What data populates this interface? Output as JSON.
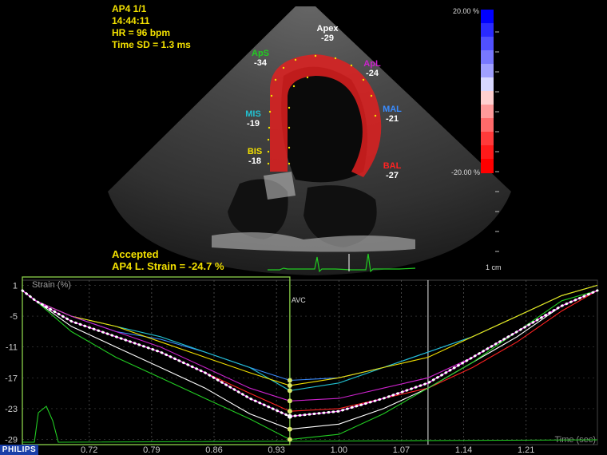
{
  "header": {
    "view": "AP4  1/1",
    "time": "14:44:11",
    "hr": "HR = 96 bpm",
    "time_sd": "Time SD = 1.3 ms"
  },
  "status": {
    "accepted": "Accepted",
    "strain": "AP4 L. Strain = -24.7 %"
  },
  "segments": [
    {
      "name": "Apex",
      "value": "-29",
      "color": "#ffffff"
    },
    {
      "name": "ApS",
      "value": "-34",
      "color": "#22cc22"
    },
    {
      "name": "ApL",
      "value": "-24",
      "color": "#cc22cc"
    },
    {
      "name": "MIS",
      "value": "-19",
      "color": "#22c0d0"
    },
    {
      "name": "MAL",
      "value": "-21",
      "color": "#3a8cff"
    },
    {
      "name": "BIS",
      "value": "-18",
      "color": "#f2e000"
    },
    {
      "name": "BAL",
      "value": "-27",
      "color": "#ff2222"
    }
  ],
  "colorbar": {
    "max": "20.00 %",
    "min": "-20.00 %"
  },
  "scale_label": "1 cm",
  "branding": "PHILIPS",
  "chart_data": {
    "type": "line",
    "ylabel": "Strain (%)",
    "xlabel": "Time (sec)",
    "marker_label": "AVC",
    "avc_time": 0.945,
    "cursor_time": 1.1,
    "xlim": [
      0.645,
      1.29
    ],
    "ylim": [
      -30,
      2
    ],
    "xticks": [
      "0.72",
      "0.79",
      "0.86",
      "0.93",
      "1.00",
      "1.07",
      "1.14",
      "1.21"
    ],
    "yticks": [
      "1",
      "-5",
      "-11",
      "-17",
      "-23",
      "-29"
    ],
    "x": [
      0.645,
      0.66,
      0.7,
      0.75,
      0.8,
      0.85,
      0.9,
      0.945,
      1.0,
      1.05,
      1.1,
      1.15,
      1.2,
      1.25,
      1.29
    ],
    "series": [
      {
        "name": "MAL",
        "color": "#3a8cff",
        "values": [
          0,
          -2,
          -5,
          -8,
          -9.5,
          -12,
          -15,
          -17.5,
          -17,
          -15,
          -12,
          -9,
          -5,
          -1,
          1
        ]
      },
      {
        "name": "MIS",
        "color": "#22c0d0",
        "values": [
          0,
          -2,
          -5,
          -7,
          -9,
          -12,
          -15,
          -19.5,
          -18,
          -15,
          -12,
          -9,
          -5,
          -1,
          1
        ]
      },
      {
        "name": "BIS",
        "color": "#f2e000",
        "values": [
          0,
          -2,
          -5,
          -7,
          -10,
          -13,
          -16,
          -18.5,
          -17,
          -15,
          -13,
          -9,
          -5,
          -1,
          1
        ]
      },
      {
        "name": "ApL",
        "color": "#cc22cc",
        "values": [
          0,
          -2,
          -5,
          -8,
          -11,
          -15,
          -19,
          -21.5,
          -21,
          -19,
          -17,
          -13,
          -8,
          -3,
          0
        ]
      },
      {
        "name": "BAL",
        "color": "#ff2222",
        "values": [
          0,
          -2,
          -6,
          -9,
          -12,
          -16,
          -20,
          -23.5,
          -23,
          -21,
          -19,
          -15,
          -10,
          -4,
          0
        ]
      },
      {
        "name": "Apex",
        "color": "#ffffff",
        "values": [
          0,
          -2,
          -7,
          -11,
          -15,
          -19,
          -24,
          -27,
          -26,
          -23,
          -19,
          -14,
          -9,
          -3,
          0
        ]
      },
      {
        "name": "ApS",
        "color": "#22cc22",
        "values": [
          0,
          -2,
          -8,
          -13,
          -17,
          -21,
          -25,
          -29,
          -28,
          -24,
          -19,
          -14,
          -8,
          -2,
          0
        ]
      },
      {
        "name": "Average",
        "color": "#ffffff",
        "dotted": true,
        "values": [
          0,
          -2,
          -6,
          -9,
          -12,
          -16,
          -21,
          -24.5,
          -23.5,
          -21,
          -18,
          -13,
          -8,
          -3,
          0
        ]
      }
    ]
  }
}
